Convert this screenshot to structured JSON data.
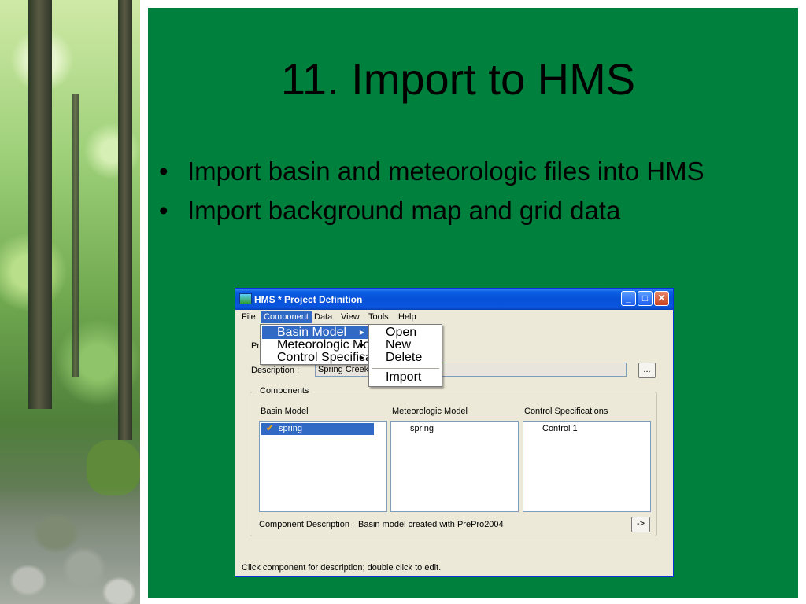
{
  "slide": {
    "title": "11. Import to HMS",
    "bullets": [
      "Import basin and meteorologic files into HMS",
      "Import background map and grid data"
    ],
    "colors": {
      "panel": "#00803d",
      "accent": "#316ac5"
    }
  },
  "window": {
    "title": "HMS * Project Definition",
    "menu": [
      "File",
      "Component",
      "Data",
      "View",
      "Tools",
      "Help"
    ],
    "active_menu": "Component",
    "project_label": "Pr",
    "description_label": "Description :",
    "description_value": "Spring Creek I",
    "browse_button": "...",
    "components_group": "Components",
    "columns": [
      "Basin Model",
      "Meteorologic Model",
      "Control Specifications"
    ],
    "basin_items": [
      "spring"
    ],
    "meteorologic_items": [
      "spring"
    ],
    "control_items": [
      "Control 1"
    ],
    "component_description_label": "Component Description :",
    "component_description_value": "Basin model created with PrePro2004",
    "arrow_button": "->",
    "status": "Click component for description; double click to edit."
  },
  "component_menu": {
    "items": [
      "Basin Model",
      "Meteorologic Model",
      "Control Specifications"
    ],
    "highlighted": "Basin Model"
  },
  "basin_submenu": {
    "items": [
      "Open",
      "New",
      "Delete",
      "Import"
    ]
  },
  "icons": [
    "app-icon",
    "minimize-icon",
    "maximize-icon",
    "close-icon",
    "check-icon",
    "submenu-arrow-icon"
  ]
}
